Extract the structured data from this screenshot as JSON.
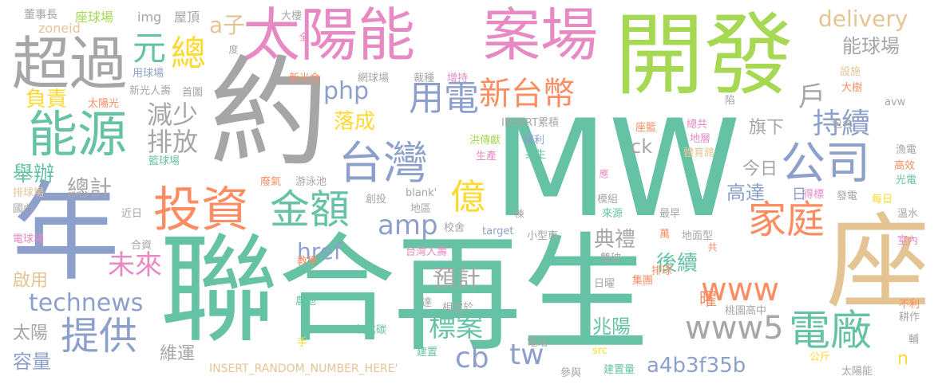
{
  "words": [
    {
      "text": "MW",
      "color": "#66c2a5"
    },
    {
      "text": "聯合",
      "color": "#66c2a5"
    },
    {
      "text": "再生",
      "color": "#66c2a5"
    },
    {
      "text": "約",
      "color": "#a6a6a6"
    },
    {
      "text": "年",
      "color": "#8da0cb"
    },
    {
      "text": "開發",
      "color": "#a6d854"
    },
    {
      "text": "座",
      "color": "#e5c494"
    },
    {
      "text": "太陽能",
      "color": "#e78ac3"
    },
    {
      "text": "案場",
      "color": "#e78ac3"
    },
    {
      "text": "超過",
      "color": "#a6a6a6"
    },
    {
      "text": "能源",
      "color": "#66c2a5"
    },
    {
      "text": "台灣",
      "color": "#8da0cb"
    },
    {
      "text": "投資",
      "color": "#fc8d62"
    },
    {
      "text": "金額",
      "color": "#66c2a5"
    },
    {
      "text": "公司",
      "color": "#8da0cb"
    },
    {
      "text": "家庭",
      "color": "#fc8d62"
    },
    {
      "text": "電廠",
      "color": "#66c2a5"
    },
    {
      "text": "提供",
      "color": "#8da0cb"
    },
    {
      "text": "用電",
      "color": "#8da0cb"
    },
    {
      "text": "新台幣",
      "color": "#fc8d62"
    },
    {
      "text": "technews",
      "color": "#8da0cb"
    },
    {
      "text": "www5",
      "color": "#a6a6a6"
    },
    {
      "text": "www",
      "color": "#fc8d62"
    },
    {
      "text": "元",
      "color": "#66c2a5"
    },
    {
      "text": "總",
      "color": "#ffd92f"
    },
    {
      "text": "億",
      "color": "#ffd92f"
    },
    {
      "text": "delivery",
      "color": "#e5c494"
    },
    {
      "text": "能球場",
      "color": "#a6a6a6"
    },
    {
      "text": "戶",
      "color": "#a6a6a6"
    },
    {
      "text": "持續",
      "color": "#8da0cb"
    },
    {
      "text": "減少",
      "color": "#a6a6a6"
    },
    {
      "text": "排放",
      "color": "#a6a6a6"
    },
    {
      "text": "php",
      "color": "#8da0cb"
    },
    {
      "text": "amp",
      "color": "#8da0cb"
    },
    {
      "text": "未來",
      "color": "#e78ac3"
    },
    {
      "text": "總計",
      "color": "#a6a6a6"
    },
    {
      "text": "舉辦",
      "color": "#66c2a5"
    },
    {
      "text": "落成",
      "color": "#ffd92f"
    },
    {
      "text": "負責",
      "color": "#ffd92f"
    },
    {
      "text": "a子",
      "color": "#e5c494"
    },
    {
      "text": "tw",
      "color": "#8da0cb"
    },
    {
      "text": "cb",
      "color": "#8da0cb"
    },
    {
      "text": "標案",
      "color": "#66c2a5"
    },
    {
      "text": "預計",
      "color": "#a6a6a6"
    },
    {
      "text": "href",
      "color": "#8da0cb"
    },
    {
      "text": "典禮",
      "color": "#a6a6a6"
    },
    {
      "text": "後續",
      "color": "#66c2a5"
    },
    {
      "text": "兆陽",
      "color": "#66c2a5"
    },
    {
      "text": "高達",
      "color": "#8da0cb"
    },
    {
      "text": "旗下",
      "color": "#a6a6a6"
    },
    {
      "text": "今日",
      "color": "#a6a6a6"
    },
    {
      "text": "日",
      "color": "#8da0cb"
    },
    {
      "text": "曜",
      "color": "#fc8d62"
    },
    {
      "text": "ck",
      "color": "#a6a6a6"
    },
    {
      "text": "a4b3f35b",
      "color": "#8da0cb"
    },
    {
      "text": "n",
      "color": "#ffd92f"
    },
    {
      "text": "容量",
      "color": "#8da0cb"
    },
    {
      "text": "太陽",
      "color": "#a6a6a6"
    },
    {
      "text": "維運",
      "color": "#a6a6a6"
    },
    {
      "text": "啟用",
      "color": "#e5c494"
    },
    {
      "text": "INSERT_RANDOM_NUMBER_HERE'",
      "color": "#e5c494"
    },
    {
      "text": "董事長",
      "color": "#a6a6a6"
    },
    {
      "text": "座球場",
      "color": "#a6d854"
    },
    {
      "text": "img",
      "color": "#a6a6a6"
    },
    {
      "text": "屋頂",
      "color": "#a6a6a6"
    },
    {
      "text": "zoneid",
      "color": "#e5c494"
    },
    {
      "text": "用球場",
      "color": "#8da0cb"
    },
    {
      "text": "大樓",
      "color": "#a6a6a6"
    },
    {
      "text": "新光金",
      "color": "#fc8d62"
    },
    {
      "text": "網球場",
      "color": "#a6a6a6"
    },
    {
      "text": "首圖",
      "color": "#a6a6a6"
    },
    {
      "text": "裁種",
      "color": "#a6a6a6"
    },
    {
      "text": "增持",
      "color": "#e78ac3"
    },
    {
      "text": "新光人壽",
      "color": "#a6a6a6"
    },
    {
      "text": "太陽光",
      "color": "#fc8d62"
    },
    {
      "text": "INSERT累積",
      "color": "#a6a6a6"
    },
    {
      "text": "洪傳獻",
      "color": "#a6d854"
    },
    {
      "text": "生產",
      "color": "#e78ac3"
    },
    {
      "text": "權利",
      "color": "#8da0cb"
    },
    {
      "text": "共生",
      "color": "#66c2a5"
    },
    {
      "text": "總共",
      "color": "#e78ac3"
    },
    {
      "text": "地層",
      "color": "#e78ac3"
    },
    {
      "text": "座籃",
      "color": "#fc8d62"
    },
    {
      "text": "包含",
      "color": "#a6a6a6"
    },
    {
      "text": "體育館",
      "color": "#e5c494"
    },
    {
      "text": "籃球場",
      "color": "#66c2a5"
    },
    {
      "text": "廢氣",
      "color": "#fc8d62"
    },
    {
      "text": "游泳池",
      "color": "#a6a6a6"
    },
    {
      "text": "blank'",
      "color": "#a6a6a6"
    },
    {
      "text": "地區",
      "color": "#a6a6a6"
    },
    {
      "text": "創投",
      "color": "#a6a6a6"
    },
    {
      "text": "近日",
      "color": "#a6a6a6"
    },
    {
      "text": "排球場",
      "color": "#e5c494"
    },
    {
      "text": "國內",
      "color": "#a6a6a6"
    },
    {
      "text": "電球場",
      "color": "#e78ac3"
    },
    {
      "text": "合資",
      "color": "#a6a6a6"
    },
    {
      "text": "校舍",
      "color": "#a6a6a6"
    },
    {
      "text": "target",
      "color": "#8da0cb"
    },
    {
      "text": "小型車",
      "color": "#a6a6a6"
    },
    {
      "text": "模組",
      "color": "#a6a6a6"
    },
    {
      "text": "來源",
      "color": "#66c2a5"
    },
    {
      "text": "最早",
      "color": "#a6a6a6"
    },
    {
      "text": "萬",
      "color": "#fc8d62"
    },
    {
      "text": "地面型",
      "color": "#a6a6a6"
    },
    {
      "text": "台灣人壽",
      "color": "#e78ac3"
    },
    {
      "text": "教學",
      "color": "#fc8d62"
    },
    {
      "text": "雙玻",
      "color": "#a6a6a6"
    },
    {
      "text": "排球",
      "color": "#fc8d62"
    },
    {
      "text": "集團",
      "color": "#fc8d62"
    },
    {
      "text": "日曜",
      "color": "#a6a6a6"
    },
    {
      "text": "桃園高中",
      "color": "#a6a6a6"
    },
    {
      "text": "農地",
      "color": "#66c2a5"
    },
    {
      "text": "達",
      "color": "#a6a6a6"
    },
    {
      "text": "相當於",
      "color": "#a6a6a6"
    },
    {
      "text": "二氧化碳",
      "color": "#66c2a5"
    },
    {
      "text": "電站",
      "color": "#a6a6a6"
    },
    {
      "text": "建置",
      "color": "#66c2a5"
    },
    {
      "text": "src",
      "color": "#ffd92f"
    },
    {
      "text": "參與",
      "color": "#a6a6a6"
    },
    {
      "text": "建置量",
      "color": "#66c2a5"
    },
    {
      "text": "手",
      "color": "#ffd92f"
    },
    {
      "text": "設施",
      "color": "#e5c494"
    },
    {
      "text": "大樹",
      "color": "#fc8d62"
    },
    {
      "text": "陷",
      "color": "#a6a6a6"
    },
    {
      "text": "avw",
      "color": "#a6a6a6"
    },
    {
      "text": "漁電",
      "color": "#a6a6a6"
    },
    {
      "text": "高效",
      "color": "#fc8d62"
    },
    {
      "text": "光電",
      "color": "#66c2a5"
    },
    {
      "text": "得標",
      "color": "#e78ac3"
    },
    {
      "text": "發電",
      "color": "#a6a6a6"
    },
    {
      "text": "每日",
      "color": "#ffd92f"
    },
    {
      "text": "溫水",
      "color": "#a6a6a6"
    },
    {
      "text": "室內",
      "color": "#e78ac3"
    },
    {
      "text": "不利",
      "color": "#fc8d62"
    },
    {
      "text": "耕作",
      "color": "#a6a6a6"
    },
    {
      "text": "輔",
      "color": "#a6a6a6"
    },
    {
      "text": "公斤",
      "color": "#ffd92f"
    },
    {
      "text": "太陽能",
      "color": "#a6a6a6"
    },
    {
      "text": "全",
      "color": "#e78ac3"
    },
    {
      "text": "度",
      "color": "#a6a6a6"
    },
    {
      "text": "應",
      "color": "#e78ac3"
    },
    {
      "text": "共",
      "color": "#fc8d62"
    },
    {
      "text": "棟",
      "color": "#a6a6a6"
    }
  ]
}
